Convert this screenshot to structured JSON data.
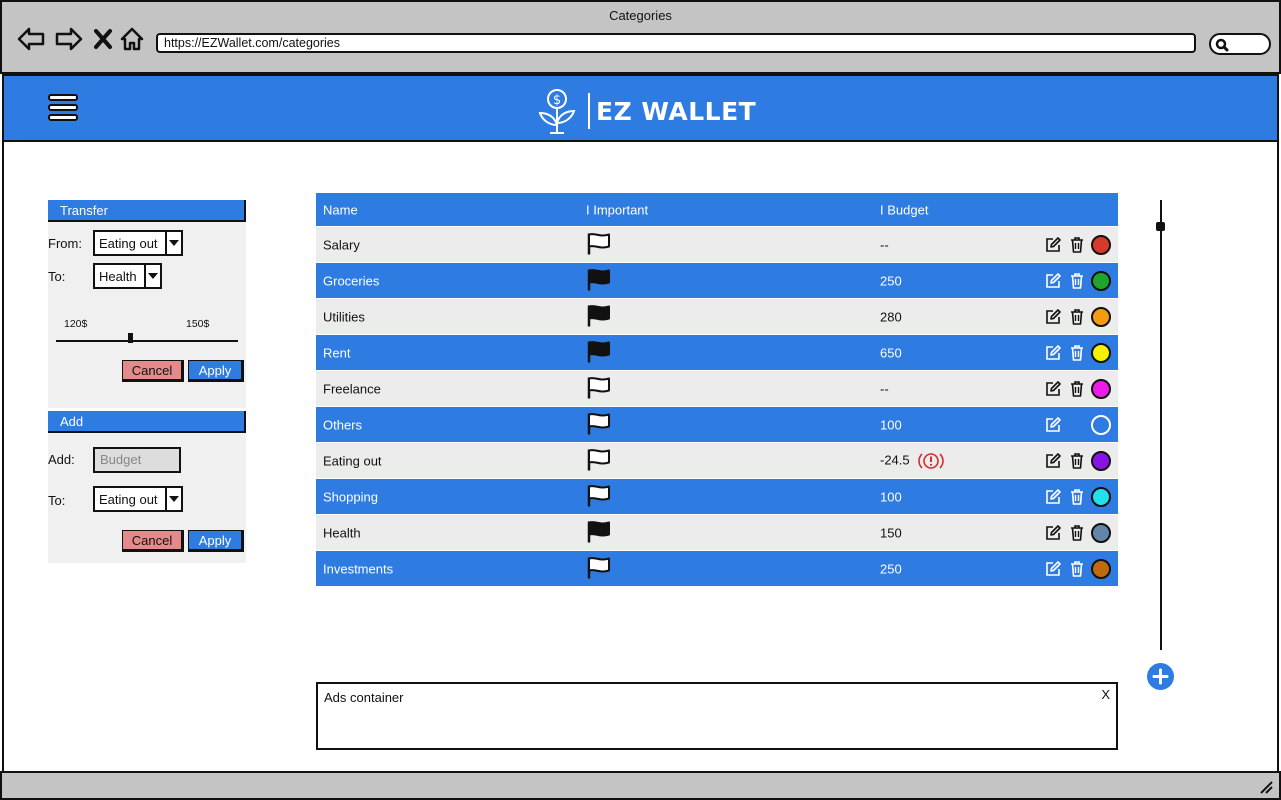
{
  "browser": {
    "title": "Categories",
    "url": "https://EZWallet.com/categories"
  },
  "header": {
    "logo_text": "EZ WALLET",
    "brand_color": "#2e7be2"
  },
  "transfer": {
    "title": "Transfer",
    "from_label": "From:",
    "from_value": "Eating out",
    "to_label": "To:",
    "to_value": "Health",
    "slider_min_label": "120$",
    "slider_max_label": "150$",
    "cancel_label": "Cancel",
    "apply_label": "Apply"
  },
  "add": {
    "title": "Add",
    "add_label": "Add:",
    "budget_placeholder": "Budget",
    "to_label": "To:",
    "to_value": "Eating out",
    "cancel_label": "Cancel",
    "apply_label": "Apply"
  },
  "table": {
    "columns": [
      "Name",
      "I  Important",
      "I Budget"
    ],
    "rows": [
      {
        "name": "Salary",
        "important": false,
        "budget": "--",
        "color": "#d63a2b",
        "deletable": true,
        "warning": false
      },
      {
        "name": "Groceries",
        "important": true,
        "budget": "250",
        "color": "#1ea52a",
        "deletable": true,
        "warning": false
      },
      {
        "name": "Utilities",
        "important": true,
        "budget": "280",
        "color": "#f39c12",
        "deletable": true,
        "warning": false
      },
      {
        "name": "Rent",
        "important": true,
        "budget": "650",
        "color": "#f5f000",
        "deletable": true,
        "warning": false
      },
      {
        "name": "Freelance",
        "important": false,
        "budget": "--",
        "color": "#ee1ae8",
        "deletable": true,
        "warning": false
      },
      {
        "name": "Others",
        "important": false,
        "budget": "100",
        "color": "#2e7be2",
        "deletable": false,
        "warning": false
      },
      {
        "name": "Eating out",
        "important": false,
        "budget": "-24.5",
        "color": "#8a12e6",
        "deletable": true,
        "warning": true
      },
      {
        "name": "Shopping",
        "important": false,
        "budget": "100",
        "color": "#22e0ec",
        "deletable": true,
        "warning": false
      },
      {
        "name": "Health",
        "important": true,
        "budget": "150",
        "color": "#6585a8",
        "deletable": true,
        "warning": false
      },
      {
        "name": "Investments",
        "important": false,
        "budget": "250",
        "color": "#c06a10",
        "deletable": true,
        "warning": false
      }
    ]
  },
  "ads": {
    "label": "Ads container",
    "close_label": "X"
  }
}
